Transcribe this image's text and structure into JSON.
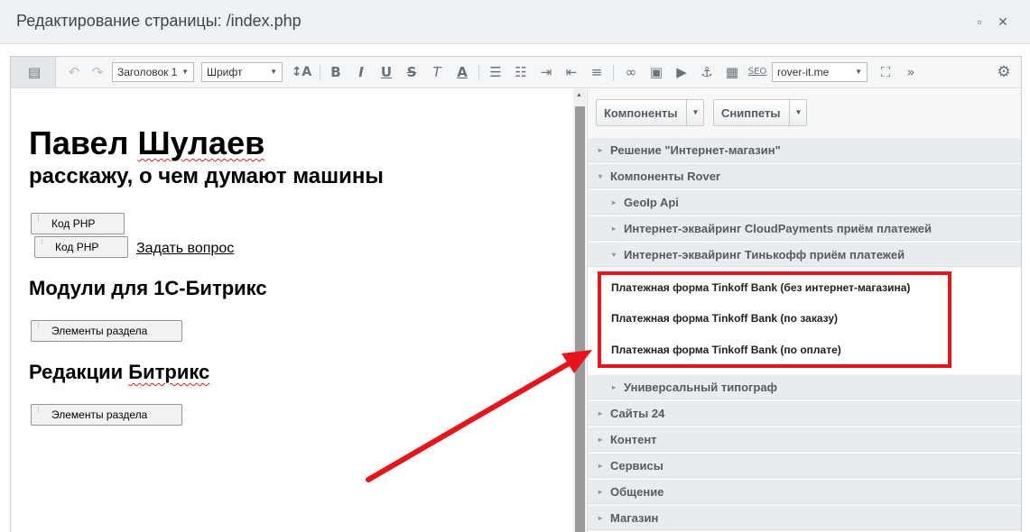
{
  "window": {
    "title": "Редактирование страницы: /index.php",
    "maximize_icon": "square-icon",
    "close_icon": "close-icon"
  },
  "toolbar": {
    "heading_select": "Заголовок 1",
    "font_select": "Шрифт",
    "font_size_label": "↕A",
    "bold": "B",
    "italic": "I",
    "underline": "U",
    "strike": "S",
    "clear_format": "T",
    "text_color": "A",
    "seo_label": "SEO",
    "site_select": "rover-it.me"
  },
  "editor": {
    "title": "Павел ",
    "title_wavy": "Шулаев",
    "subtitle": "расскажу, о чем думают машины",
    "component1": "Код PHP",
    "component2": "Код PHP",
    "ask_link": "Задать вопрос",
    "heading2": "Модули для 1С-Битрикс",
    "component3": "Элементы раздела",
    "heading3_a": "Редакции ",
    "heading3_b": "Битрикс",
    "component4": "Элементы раздела"
  },
  "panel": {
    "components_button": "Компоненты",
    "snippets_button": "Сниппеты",
    "tree": [
      {
        "label": "Решение \"Интернет-магазин\"",
        "expanded": false
      },
      {
        "label": "Компоненты Rover",
        "expanded": true
      },
      {
        "label": "GeoIp Api",
        "expanded": false
      },
      {
        "label": "Интернет-эквайринг CloudPayments приём платежей",
        "expanded": false
      },
      {
        "label": "Интернет-эквайринг Тинькофф приём платежей",
        "expanded": true
      },
      {
        "label": "Универсальный типограф",
        "expanded": false
      },
      {
        "label": "Сайты 24",
        "expanded": false
      },
      {
        "label": "Контент",
        "expanded": false
      },
      {
        "label": "Сервисы",
        "expanded": false
      },
      {
        "label": "Общение",
        "expanded": false
      },
      {
        "label": "Магазин",
        "expanded": false
      }
    ],
    "leaves": [
      "Платежная форма Tinkoff Bank (без интернет-магазина)",
      "Платежная форма Tinkoff Bank (по заказу)",
      "Платежная форма Tinkoff Bank (по оплате)"
    ]
  },
  "colors": {
    "highlight": "#e8141c",
    "panel_row": "#e9ecee",
    "titlebar": "#eef1f3"
  }
}
